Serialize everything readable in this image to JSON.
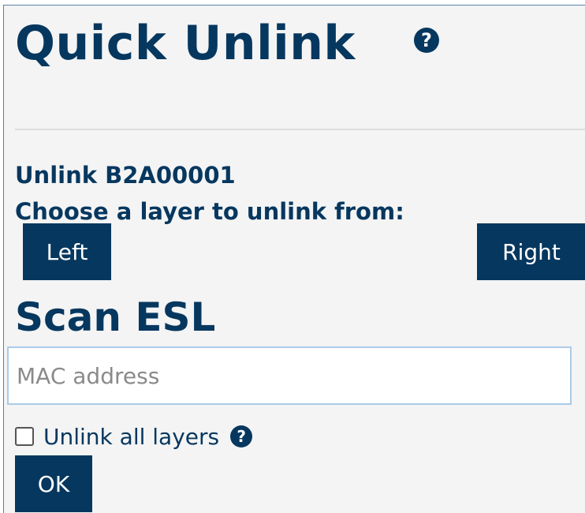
{
  "page": {
    "title": "Quick Unlink",
    "help_glyph": "?",
    "unlink_label": "Unlink B2A00001",
    "choose_label": "Choose a layer to unlink from:"
  },
  "layers": {
    "left_label": "Left",
    "right_label": "Right"
  },
  "scan": {
    "title": "Scan ESL",
    "placeholder": "MAC address",
    "value": ""
  },
  "options": {
    "unlink_all_label": "Unlink all layers",
    "unlink_all_checked": false,
    "help_glyph": "?"
  },
  "actions": {
    "ok_label": "OK"
  },
  "colors": {
    "brand_navy": "#06375f",
    "background": "#f4f4f4",
    "input_border": "#a9cbe8",
    "divider": "#dedede"
  },
  "icons": {
    "title_help": "question-circle-icon",
    "checkbox_help": "question-circle-icon"
  }
}
